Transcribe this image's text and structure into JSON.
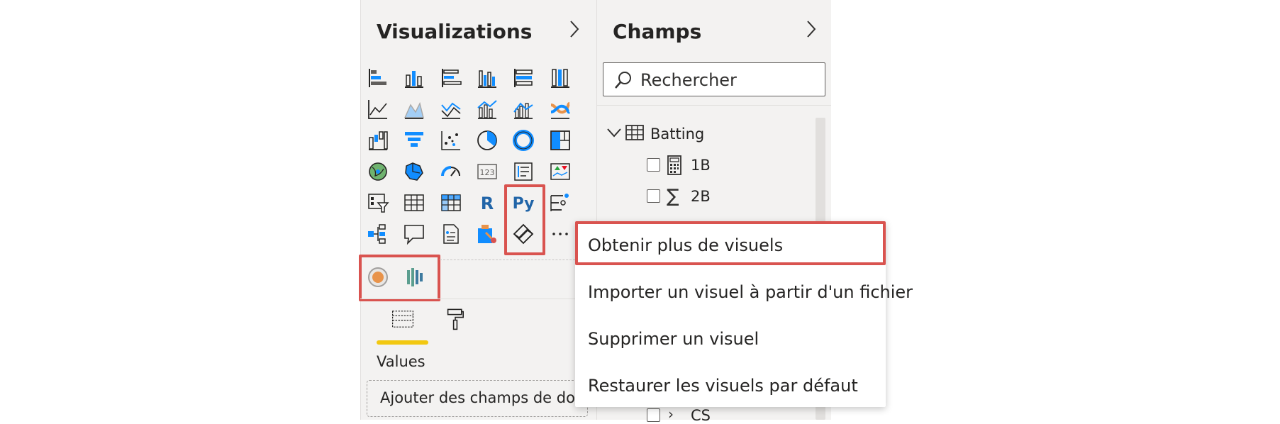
{
  "visualizations_pane": {
    "title": "Visualizations",
    "expand_icon": "chevron-right-icon",
    "icons": [
      "stacked-bar-chart-icon",
      "stacked-column-chart-icon",
      "clustered-bar-chart-icon",
      "clustered-column-chart-icon",
      "100-stacked-bar-chart-icon",
      "100-stacked-column-chart-icon",
      "line-chart-icon",
      "area-chart-icon",
      "stacked-area-chart-icon",
      "line-and-stacked-column-icon",
      "line-and-clustered-column-icon",
      "ribbon-chart-icon",
      "waterfall-chart-icon",
      "funnel-icon",
      "scatter-chart-icon",
      "pie-chart-icon",
      "donut-chart-icon",
      "treemap-icon",
      "map-icon",
      "filled-map-icon",
      "gauge-icon",
      "card-icon",
      "multi-row-card-icon",
      "kpi-icon",
      "slicer-icon",
      "table-icon",
      "matrix-icon",
      "r-visual-icon",
      "python-visual-icon",
      "key-influencers-icon",
      "decomposition-tree-icon",
      "qa-icon",
      "smart-narrative-icon",
      "paginated-report-icon",
      "power-apps-icon",
      "more-options-icon"
    ],
    "r_label": "R",
    "py_label": "Py",
    "more_label": "···",
    "custom_icons": [
      "custom-visual-1-icon",
      "custom-visual-2-icon"
    ],
    "tabs": [
      "fields-build-icon",
      "format-paint-roller-icon"
    ],
    "values_label": "Values",
    "add_fields_placeholder": "Ajouter des champs de donn"
  },
  "fields_pane": {
    "title": "Champs",
    "expand_icon": "chevron-right-icon",
    "search_placeholder": "Rechercher",
    "table_name": "Batting",
    "fields": [
      {
        "name": "1B",
        "icon": "calculator-icon"
      },
      {
        "name": "2B",
        "icon": "sigma-icon"
      }
    ],
    "last_field": "CS"
  },
  "context_menu": {
    "items": [
      "Obtenir plus de visuels",
      "Importer un visuel à partir d'un fichier",
      "Supprimer un visuel",
      "Restaurer les visuels par défaut"
    ]
  },
  "colors": {
    "highlight_red": "#d9534f",
    "accent_blue": "#118dff",
    "accent_yellow": "#f2c811",
    "pane_bg": "#f3f2f1"
  }
}
